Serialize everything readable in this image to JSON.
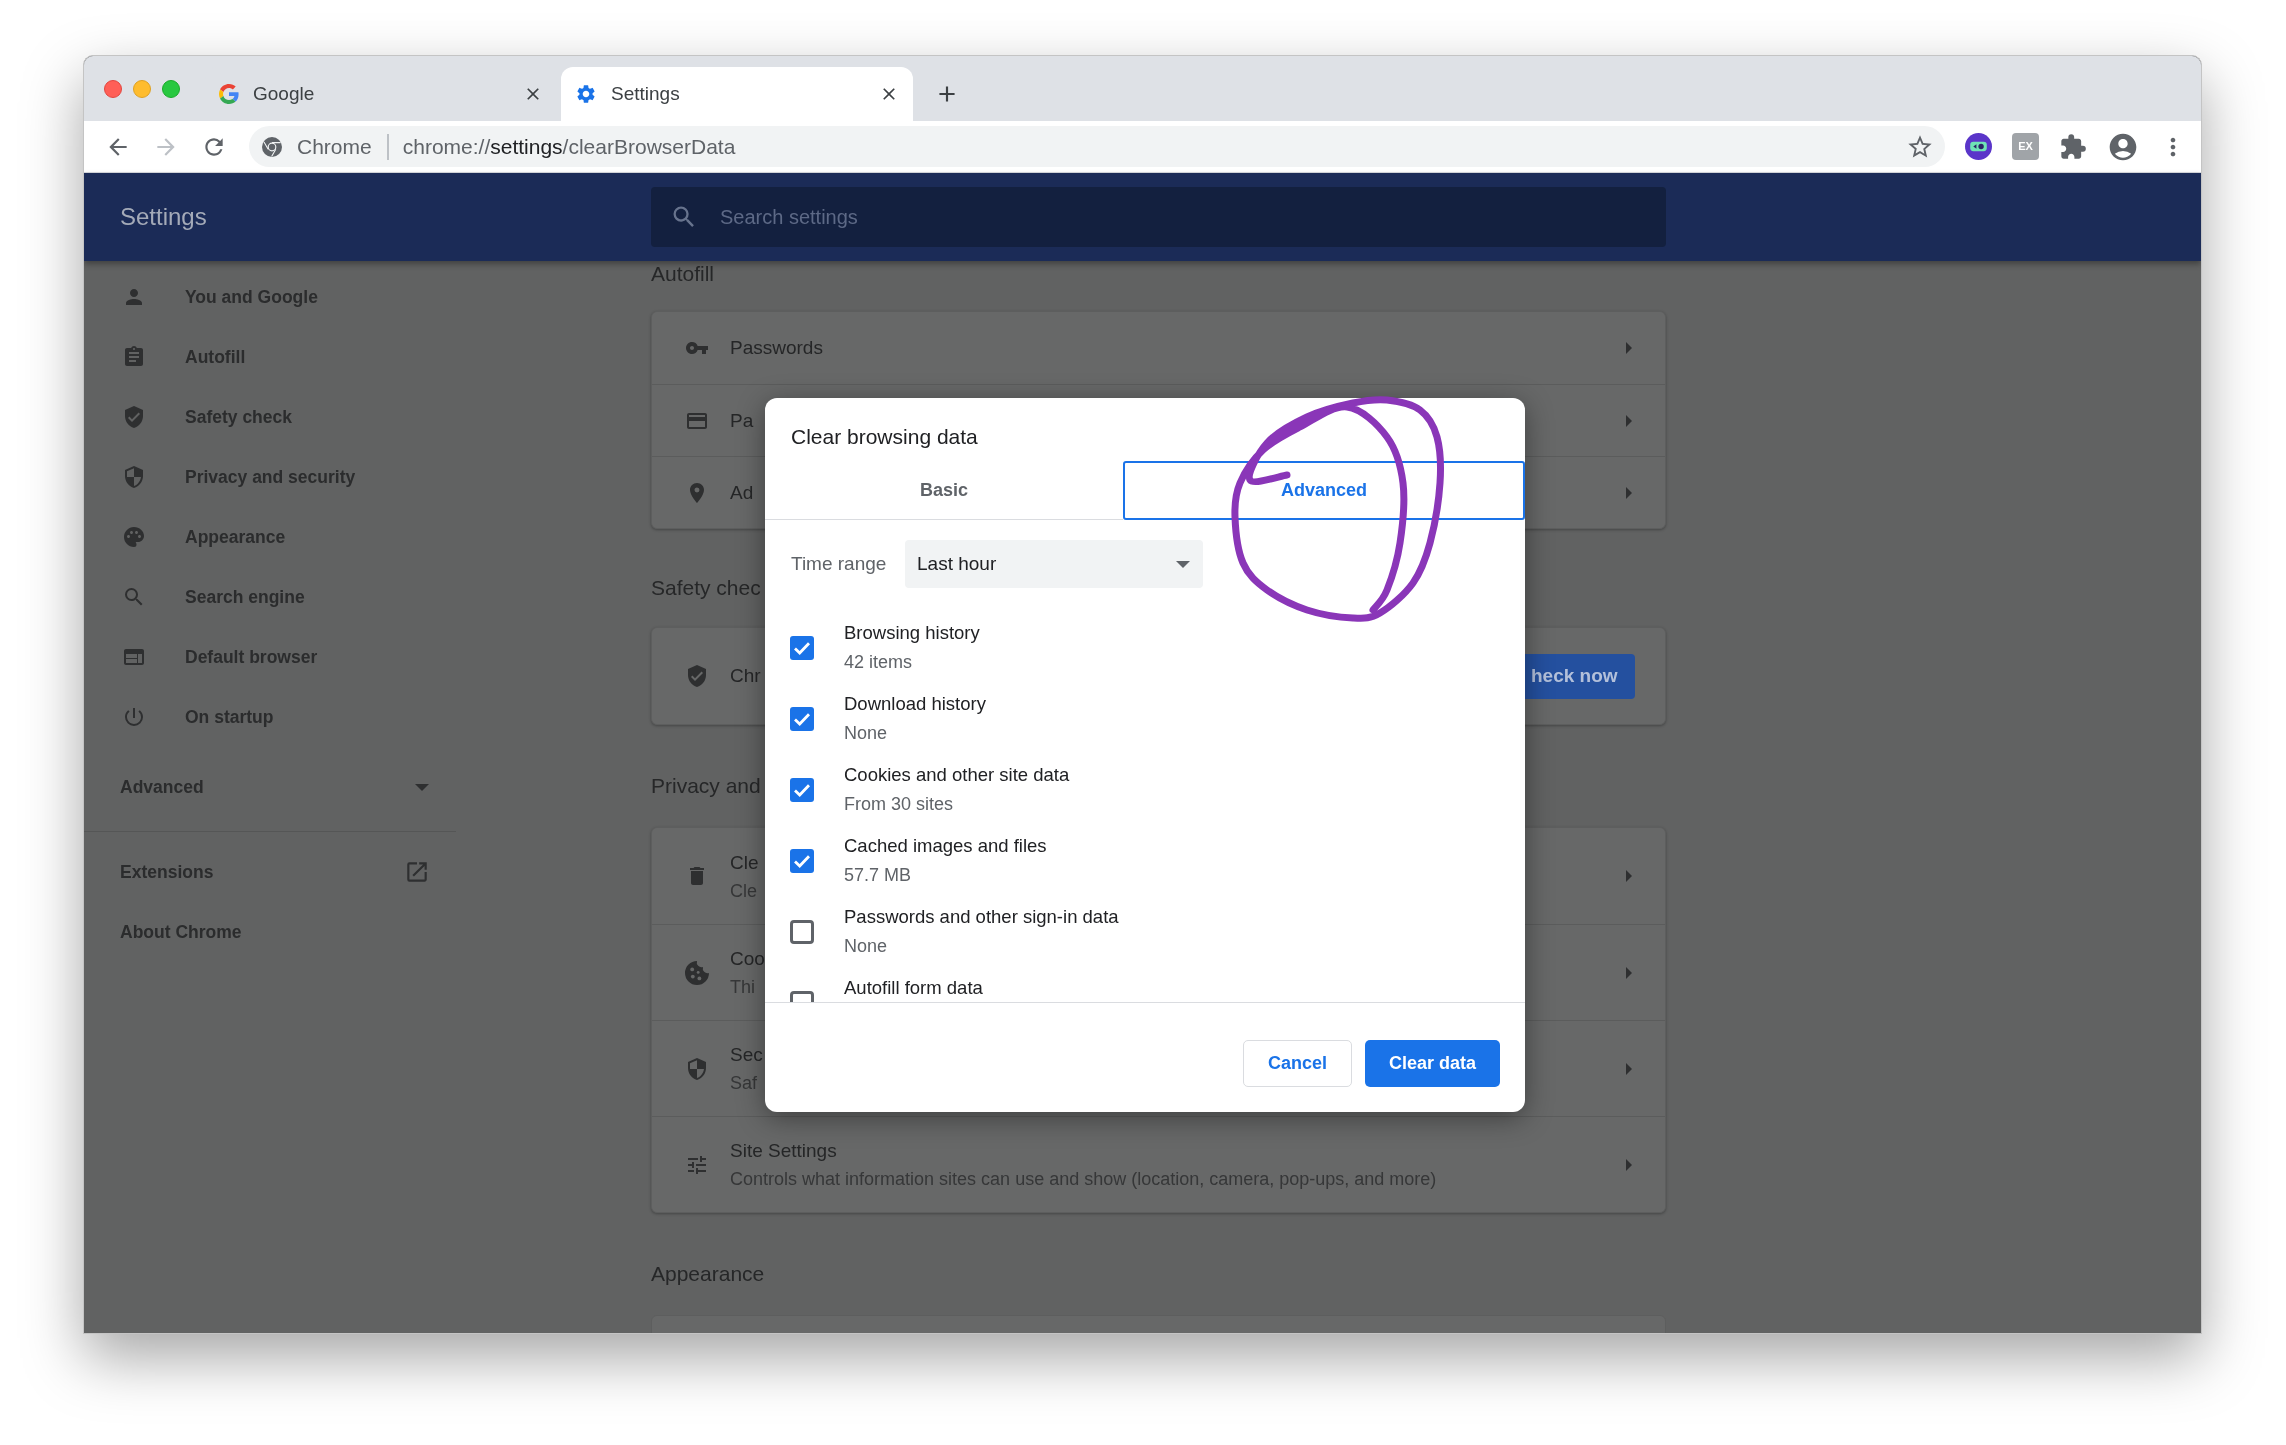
{
  "browser": {
    "tabs": [
      {
        "title": "Google",
        "kind": "google",
        "selected": false
      },
      {
        "title": "Settings",
        "kind": "settings",
        "selected": true
      }
    ],
    "nav_buttons": [
      {
        "kind": "back",
        "disabled": false
      },
      {
        "kind": "forward",
        "disabled": true
      },
      {
        "kind": "reload",
        "disabled": false
      }
    ],
    "address_bar": {
      "site_label": "Chrome",
      "url": {
        "scheme": "chrome://",
        "host": "settings",
        "path": "/clearBrowserData"
      }
    },
    "extension_label": "EX"
  },
  "settings": {
    "title": "Settings",
    "search": {
      "placeholder": "Search settings"
    },
    "sidebar": {
      "items": [
        {
          "label": "You and Google",
          "kind": "person"
        },
        {
          "label": "Autofill",
          "kind": "clipboard"
        },
        {
          "label": "Safety check",
          "kind": "shield-check"
        },
        {
          "label": "Privacy and security",
          "kind": "shield-half"
        },
        {
          "label": "Appearance",
          "kind": "palette"
        },
        {
          "label": "Search engine",
          "kind": "search"
        },
        {
          "label": "Default browser",
          "kind": "browser"
        },
        {
          "label": "On startup",
          "kind": "power"
        }
      ],
      "advanced": {
        "label": "Advanced",
        "expanded": false
      },
      "links": [
        {
          "label": "Extensions",
          "external": true
        },
        {
          "label": "About Chrome",
          "external": false
        }
      ]
    },
    "sections": [
      {
        "heading": "Autofill",
        "rows": [
          {
            "kind": "key",
            "title": "Passwords"
          },
          {
            "kind": "card",
            "title": "Pa"
          },
          {
            "kind": "pin",
            "title": "Ad"
          }
        ]
      },
      {
        "heading": "Safety chec",
        "rows": [
          {
            "kind": "shield-check",
            "title": "Chr",
            "button": "heck now"
          }
        ]
      },
      {
        "heading": "Privacy and",
        "rows": [
          {
            "kind": "trash",
            "title": "Cle",
            "subtitle": "Cle"
          },
          {
            "kind": "cookie",
            "title": "Coo",
            "subtitle": "Thi"
          },
          {
            "kind": "shield-half",
            "title": "Sec",
            "subtitle": "Saf"
          },
          {
            "kind": "tune",
            "title": "Site Settings",
            "subtitle": "Controls what information sites can use and show (location, camera, pop-ups, and more)"
          }
        ]
      },
      {
        "heading": "Appearance"
      }
    ]
  },
  "dialog": {
    "title": "Clear browsing data",
    "tabs": [
      {
        "label": "Basic",
        "selected": false
      },
      {
        "label": "Advanced",
        "selected": true
      }
    ],
    "time_range": {
      "label": "Time range",
      "value": "Last hour"
    },
    "items": [
      {
        "label": "Browsing history",
        "detail": "42 items",
        "checked": true
      },
      {
        "label": "Download history",
        "detail": "None",
        "checked": true
      },
      {
        "label": "Cookies and other site data",
        "detail": "From 30 sites",
        "checked": true
      },
      {
        "label": "Cached images and files",
        "detail": "57.7 MB",
        "checked": true
      },
      {
        "label": "Passwords and other sign-in data",
        "detail": "None",
        "checked": false
      },
      {
        "label": "Autofill form data",
        "checked": false
      }
    ],
    "buttons": [
      {
        "label": "Cancel",
        "kind": "secondary"
      },
      {
        "label": "Clear data",
        "kind": "primary"
      }
    ]
  }
}
